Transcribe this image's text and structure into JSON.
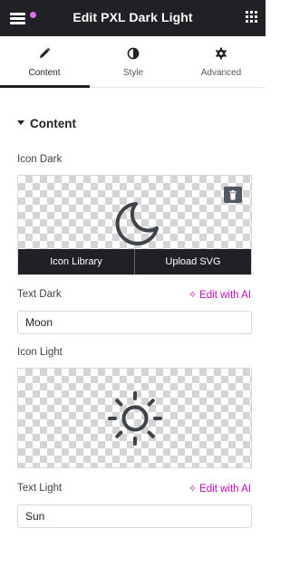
{
  "header": {
    "title": "Edit PXL Dark Light",
    "menu_icon": "hamburger-icon",
    "grid_icon": "apps-grid-icon",
    "notification_dot_color": "#e46cf0"
  },
  "tabs": [
    {
      "label": "Content",
      "icon": "pencil-icon",
      "active": true
    },
    {
      "label": "Style",
      "icon": "contrast-icon",
      "active": false
    },
    {
      "label": "Advanced",
      "icon": "gear-icon",
      "active": false
    }
  ],
  "section": {
    "title": "Content",
    "expanded": true
  },
  "icon_dark": {
    "label": "Icon Dark",
    "icon": "moon-icon",
    "library_label": "Icon Library",
    "upload_label": "Upload SVG"
  },
  "text_dark": {
    "label": "Text Dark",
    "ai_label": "Edit with AI",
    "value": "Moon"
  },
  "icon_light": {
    "label": "Icon Light",
    "icon": "sun-icon"
  },
  "text_light": {
    "label": "Text Light",
    "ai_label": "Edit with AI",
    "value": "Sun"
  },
  "colors": {
    "accent_ai": "#c00bb9",
    "header_bg": "#1f2124"
  }
}
